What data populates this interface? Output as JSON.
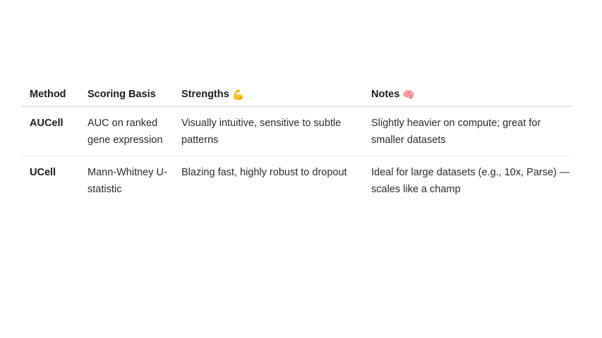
{
  "table": {
    "headers": {
      "method": "Method",
      "scoring": "Scoring Basis",
      "strengths": "Strengths",
      "strengths_emoji": "💪",
      "notes": "Notes",
      "notes_emoji": "🧠"
    },
    "rows": [
      {
        "method": "AUCell",
        "scoring": "AUC on ranked gene expression",
        "strengths": "Visually intuitive, sensitive to subtle patterns",
        "notes": "Slightly heavier on compute; great for smaller datasets"
      },
      {
        "method": "UCell",
        "scoring": "Mann-Whitney U-statistic",
        "strengths": "Blazing fast, highly robust to dropout",
        "notes": "Ideal for large datasets (e.g., 10x, Parse) — scales like a champ"
      }
    ]
  }
}
